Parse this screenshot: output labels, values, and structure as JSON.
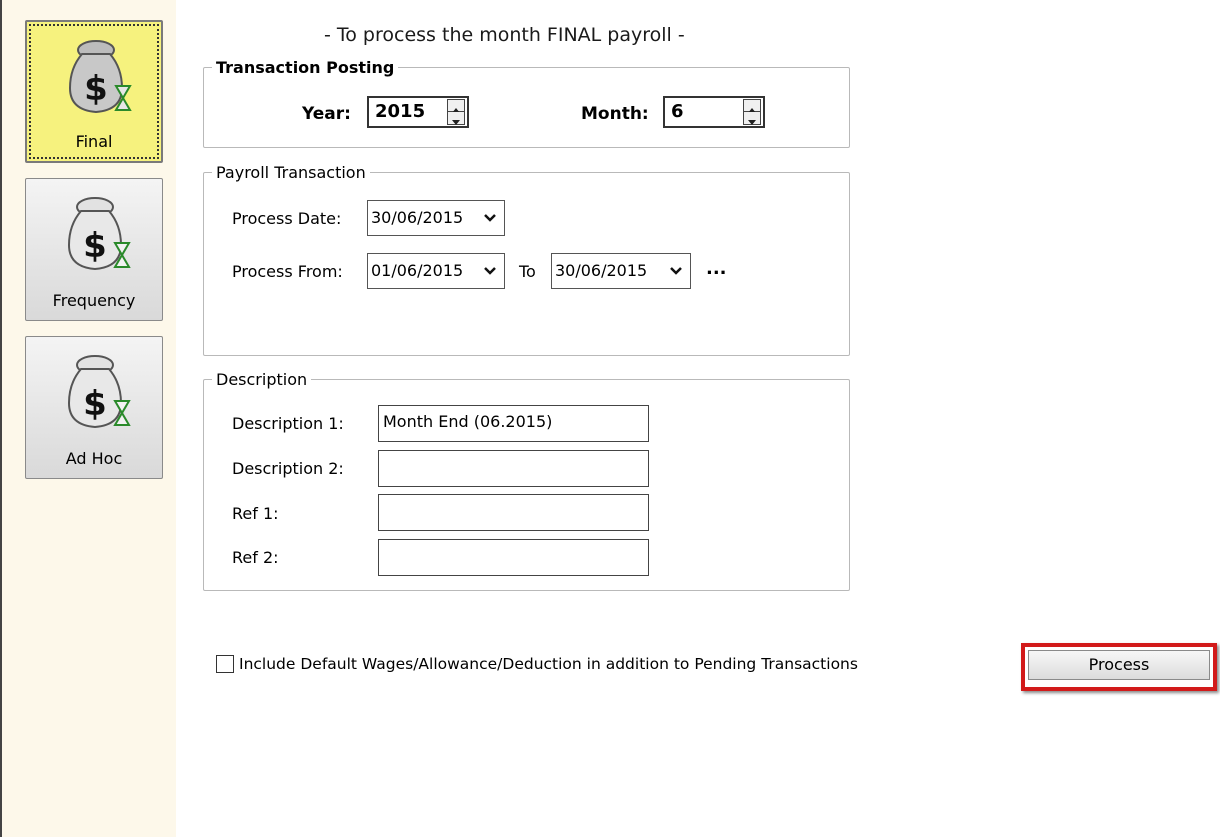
{
  "sidebar": {
    "items": [
      {
        "label": "Final",
        "icon": "money-bag-icon",
        "active": true
      },
      {
        "label": "Frequency",
        "icon": "money-bag-icon",
        "active": false
      },
      {
        "label": "Ad Hoc",
        "icon": "money-bag-icon",
        "active": false
      }
    ]
  },
  "main": {
    "title": "- To process the month FINAL payroll -",
    "transaction_posting": {
      "legend": "Transaction Posting",
      "year_label": "Year:",
      "year_value": "2015",
      "month_label": "Month:",
      "month_value": "6"
    },
    "payroll_transaction": {
      "legend": "Payroll Transaction",
      "process_date_label": "Process Date:",
      "process_date_value": "30/06/2015",
      "process_from_label": "Process From:",
      "process_from_value": "01/06/2015",
      "to_label": "To",
      "process_to_value": "30/06/2015",
      "more_label": "..."
    },
    "description": {
      "legend": "Description",
      "desc1_label": "Description 1:",
      "desc1_value": "Month End (06.2015)",
      "desc2_label": "Description 2:",
      "desc2_value": "",
      "ref1_label": "Ref 1:",
      "ref1_value": "",
      "ref2_label": "Ref 2:",
      "ref2_value": ""
    },
    "include_default_label": "Include Default Wages/Allowance/Deduction in addition to Pending Transactions",
    "include_default_checked": false,
    "process_label": "Process"
  },
  "colors": {
    "sidebar_bg": "#fdf8ea",
    "active_button": "#f6f27e",
    "highlight_border": "#d21a1a"
  }
}
